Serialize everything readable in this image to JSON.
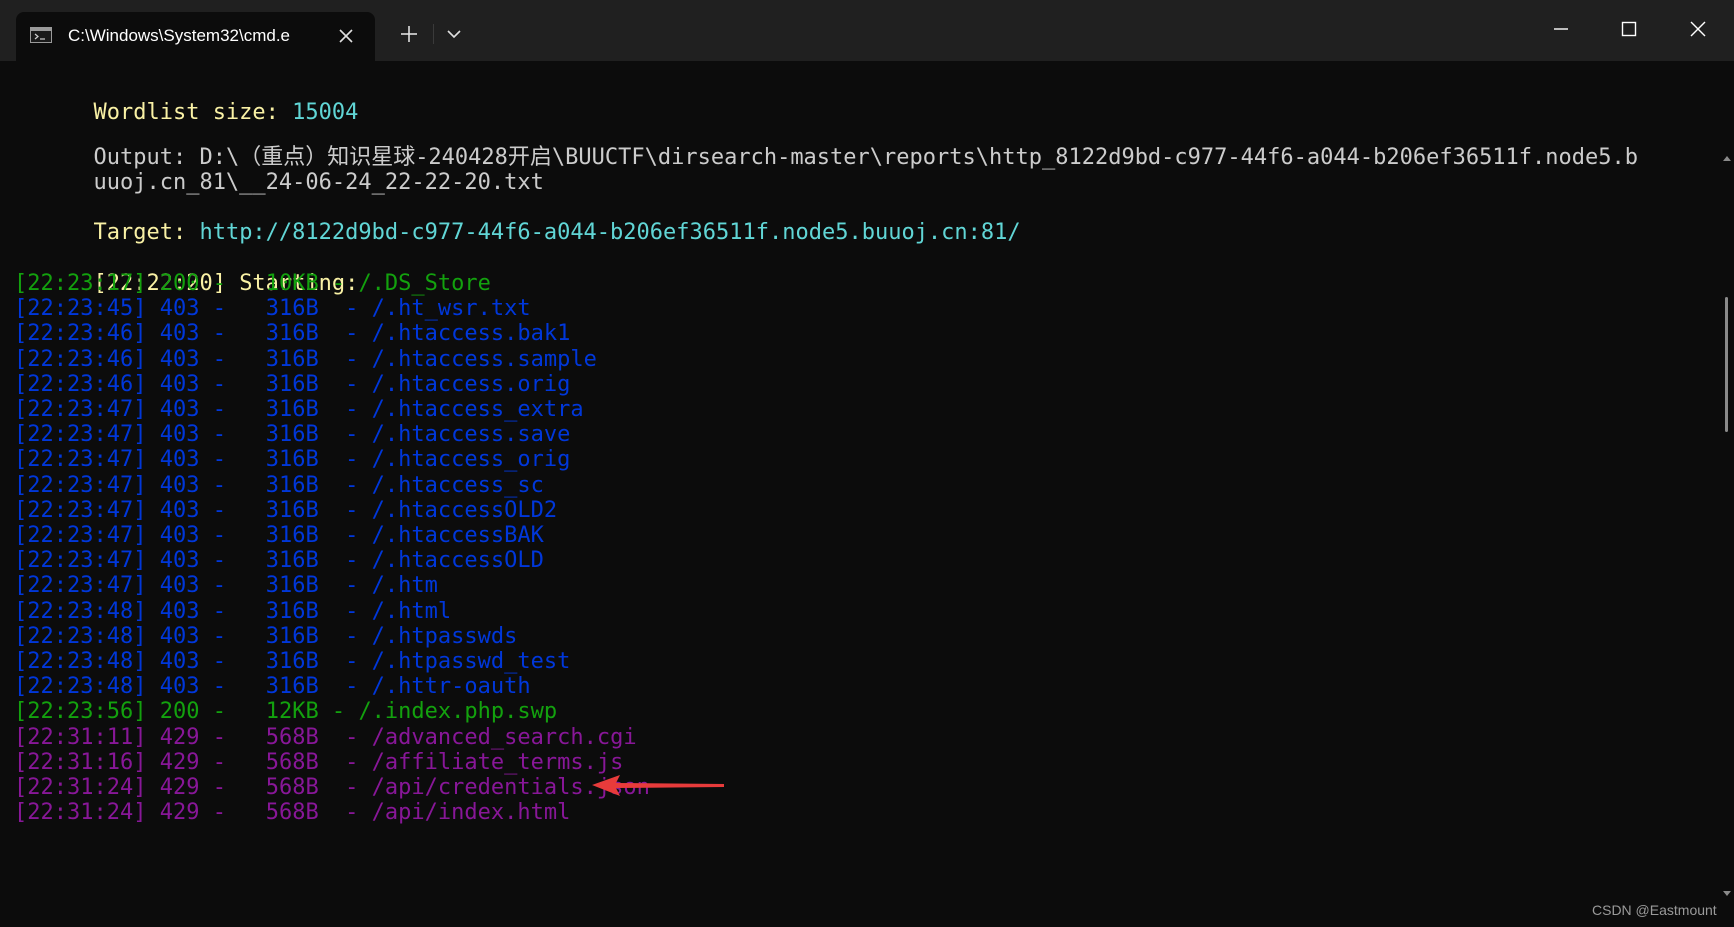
{
  "window": {
    "tab_title": "C:\\Windows\\System32\\cmd.e",
    "icons": {
      "tab": "terminal-icon",
      "tab_close": "close-icon",
      "new_tab": "plus-icon",
      "dropdown": "chevron-down-icon",
      "minimize": "minimize-icon",
      "maximize": "maximize-icon",
      "close": "close-icon"
    }
  },
  "colors": {
    "background": "#0c0c0c",
    "titlebar": "#202020",
    "yellow": "#f9f1a5",
    "cyan": "#61d6d6",
    "green": "#13a10e",
    "blue": "#0037da",
    "magenta": "#881798",
    "annotation_arrow": "#e83b3b"
  },
  "header": {
    "wordlist_label": "Wordlist size:",
    "wordlist_value": "15004",
    "output_label": "Output:",
    "output_line1": "D:\\（重点）知识星球-240428开启\\BUUCTF\\dirsearch-master\\reports\\http_8122d9bd-c977-44f6-a044-b206ef36511f.node5.b",
    "output_line2": "uuoj.cn_81\\__24-06-24_22-22-20.txt",
    "target_label": "Target:",
    "target_value": "http://8122d9bd-c977-44f6-a044-b206ef36511f.node5.buuoj.cn:81/",
    "start_time": "[22:22:20]",
    "start_label": "Starting:"
  },
  "results": [
    {
      "time": "[22:23:17]",
      "code": "200",
      "size": "10KB",
      "path": "/.DS_Store",
      "status": "ok"
    },
    {
      "time": "[22:23:45]",
      "code": "403",
      "size": "316B",
      "path": "/.ht_wsr.txt",
      "status": "forbidden"
    },
    {
      "time": "[22:23:46]",
      "code": "403",
      "size": "316B",
      "path": "/.htaccess.bak1",
      "status": "forbidden"
    },
    {
      "time": "[22:23:46]",
      "code": "403",
      "size": "316B",
      "path": "/.htaccess.sample",
      "status": "forbidden"
    },
    {
      "time": "[22:23:46]",
      "code": "403",
      "size": "316B",
      "path": "/.htaccess.orig",
      "status": "forbidden"
    },
    {
      "time": "[22:23:47]",
      "code": "403",
      "size": "316B",
      "path": "/.htaccess_extra",
      "status": "forbidden"
    },
    {
      "time": "[22:23:47]",
      "code": "403",
      "size": "316B",
      "path": "/.htaccess.save",
      "status": "forbidden"
    },
    {
      "time": "[22:23:47]",
      "code": "403",
      "size": "316B",
      "path": "/.htaccess_orig",
      "status": "forbidden"
    },
    {
      "time": "[22:23:47]",
      "code": "403",
      "size": "316B",
      "path": "/.htaccess_sc",
      "status": "forbidden"
    },
    {
      "time": "[22:23:47]",
      "code": "403",
      "size": "316B",
      "path": "/.htaccessOLD2",
      "status": "forbidden"
    },
    {
      "time": "[22:23:47]",
      "code": "403",
      "size": "316B",
      "path": "/.htaccessBAK",
      "status": "forbidden"
    },
    {
      "time": "[22:23:47]",
      "code": "403",
      "size": "316B",
      "path": "/.htaccessOLD",
      "status": "forbidden"
    },
    {
      "time": "[22:23:47]",
      "code": "403",
      "size": "316B",
      "path": "/.htm",
      "status": "forbidden"
    },
    {
      "time": "[22:23:48]",
      "code": "403",
      "size": "316B",
      "path": "/.html",
      "status": "forbidden"
    },
    {
      "time": "[22:23:48]",
      "code": "403",
      "size": "316B",
      "path": "/.htpasswds",
      "status": "forbidden"
    },
    {
      "time": "[22:23:48]",
      "code": "403",
      "size": "316B",
      "path": "/.htpasswd_test",
      "status": "forbidden"
    },
    {
      "time": "[22:23:48]",
      "code": "403",
      "size": "316B",
      "path": "/.httr-oauth",
      "status": "forbidden"
    },
    {
      "time": "[22:23:56]",
      "code": "200",
      "size": "12KB",
      "path": "/.index.php.swp",
      "status": "ok"
    },
    {
      "time": "[22:31:11]",
      "code": "429",
      "size": "568B",
      "path": "/advanced_search.cgi",
      "status": "ratelimit"
    },
    {
      "time": "[22:31:16]",
      "code": "429",
      "size": "568B",
      "path": "/affiliate_terms.js",
      "status": "ratelimit"
    },
    {
      "time": "[22:31:24]",
      "code": "429",
      "size": "568B",
      "path": "/api/credentials.json",
      "status": "ratelimit"
    },
    {
      "time": "[22:31:24]",
      "code": "429",
      "size": "568B",
      "path": "/api/index.html",
      "status": "ratelimit"
    }
  ],
  "watermark": "CSDN @Eastmount"
}
